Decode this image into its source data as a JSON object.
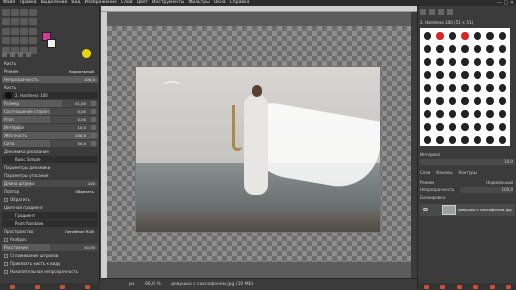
{
  "menu": [
    "Файл",
    "Правка",
    "Выделение",
    "Вид",
    "Изображение",
    "Слой",
    "Цвет",
    "Инструменты",
    "Фильтры",
    "Окна",
    "Справка"
  ],
  "window_controls": "— □ ✕",
  "tool_options": {
    "title": "Кисть",
    "mode_label": "Режим",
    "mode_value": "Нормальный",
    "opacity_label": "Непрозрачность",
    "opacity_value": "100,0",
    "brush_label": "Кисть",
    "brush_name": "2. Hardness 100",
    "size_label": "Размер",
    "size_value": "51,00",
    "ratio_label": "Соотношение сторон",
    "ratio_value": "0,00",
    "angle_label": "Угол",
    "angle_value": "0,00",
    "spacing_label": "Интервал",
    "spacing_value": "10,0",
    "hardness_label": "Жёсткость",
    "hardness_value": "100,0",
    "force_label": "Сила",
    "force_value": "50,0",
    "dynamics_label": "Динамика рисования",
    "dynamics_value": "Basic Simple",
    "dynamics_params_label": "Параметры динамики",
    "fade_params_label": "Параметры угасания",
    "fade_length_label": "Длина штриха",
    "fade_length_value": "100",
    "repeat_label": "Повтор",
    "repeat_value": "Обрезать",
    "reverse_label": "Обратить",
    "color_gradient_label": "Цветной градиент",
    "gradient_label": "Градиент",
    "gradient_value": "Paint Rainbow",
    "space_label": "Пространство",
    "space_value": "Линейное RGB",
    "jitter_label": "Разброс",
    "jitter_amount_label": "Расстояние",
    "jitter_amount_value": "50,00",
    "smooth_label": "Сглаживание штрихов",
    "lock_label": "Привязать кисть к виду",
    "incremental_label": "Накопительная непрозрачность"
  },
  "status": {
    "unit": "px",
    "zoom": "66,6 %",
    "filename": "девушка с саксофоном.jpg (10 МБ)"
  },
  "brushes": {
    "filter_label": "2. Hardness 100 (51 × 51)",
    "spacing_label": "Интервал",
    "spacing_value": "10,0"
  },
  "layers": {
    "tabs": [
      "Слои",
      "Каналы",
      "Контуры"
    ],
    "mode_label": "Режим",
    "mode_value": "Нормальный",
    "opacity_label": "Непрозрачность",
    "opacity_value": "100,0",
    "lock_label": "Блокировка:",
    "layer_name": "девушка с саксофоном.jpg"
  }
}
